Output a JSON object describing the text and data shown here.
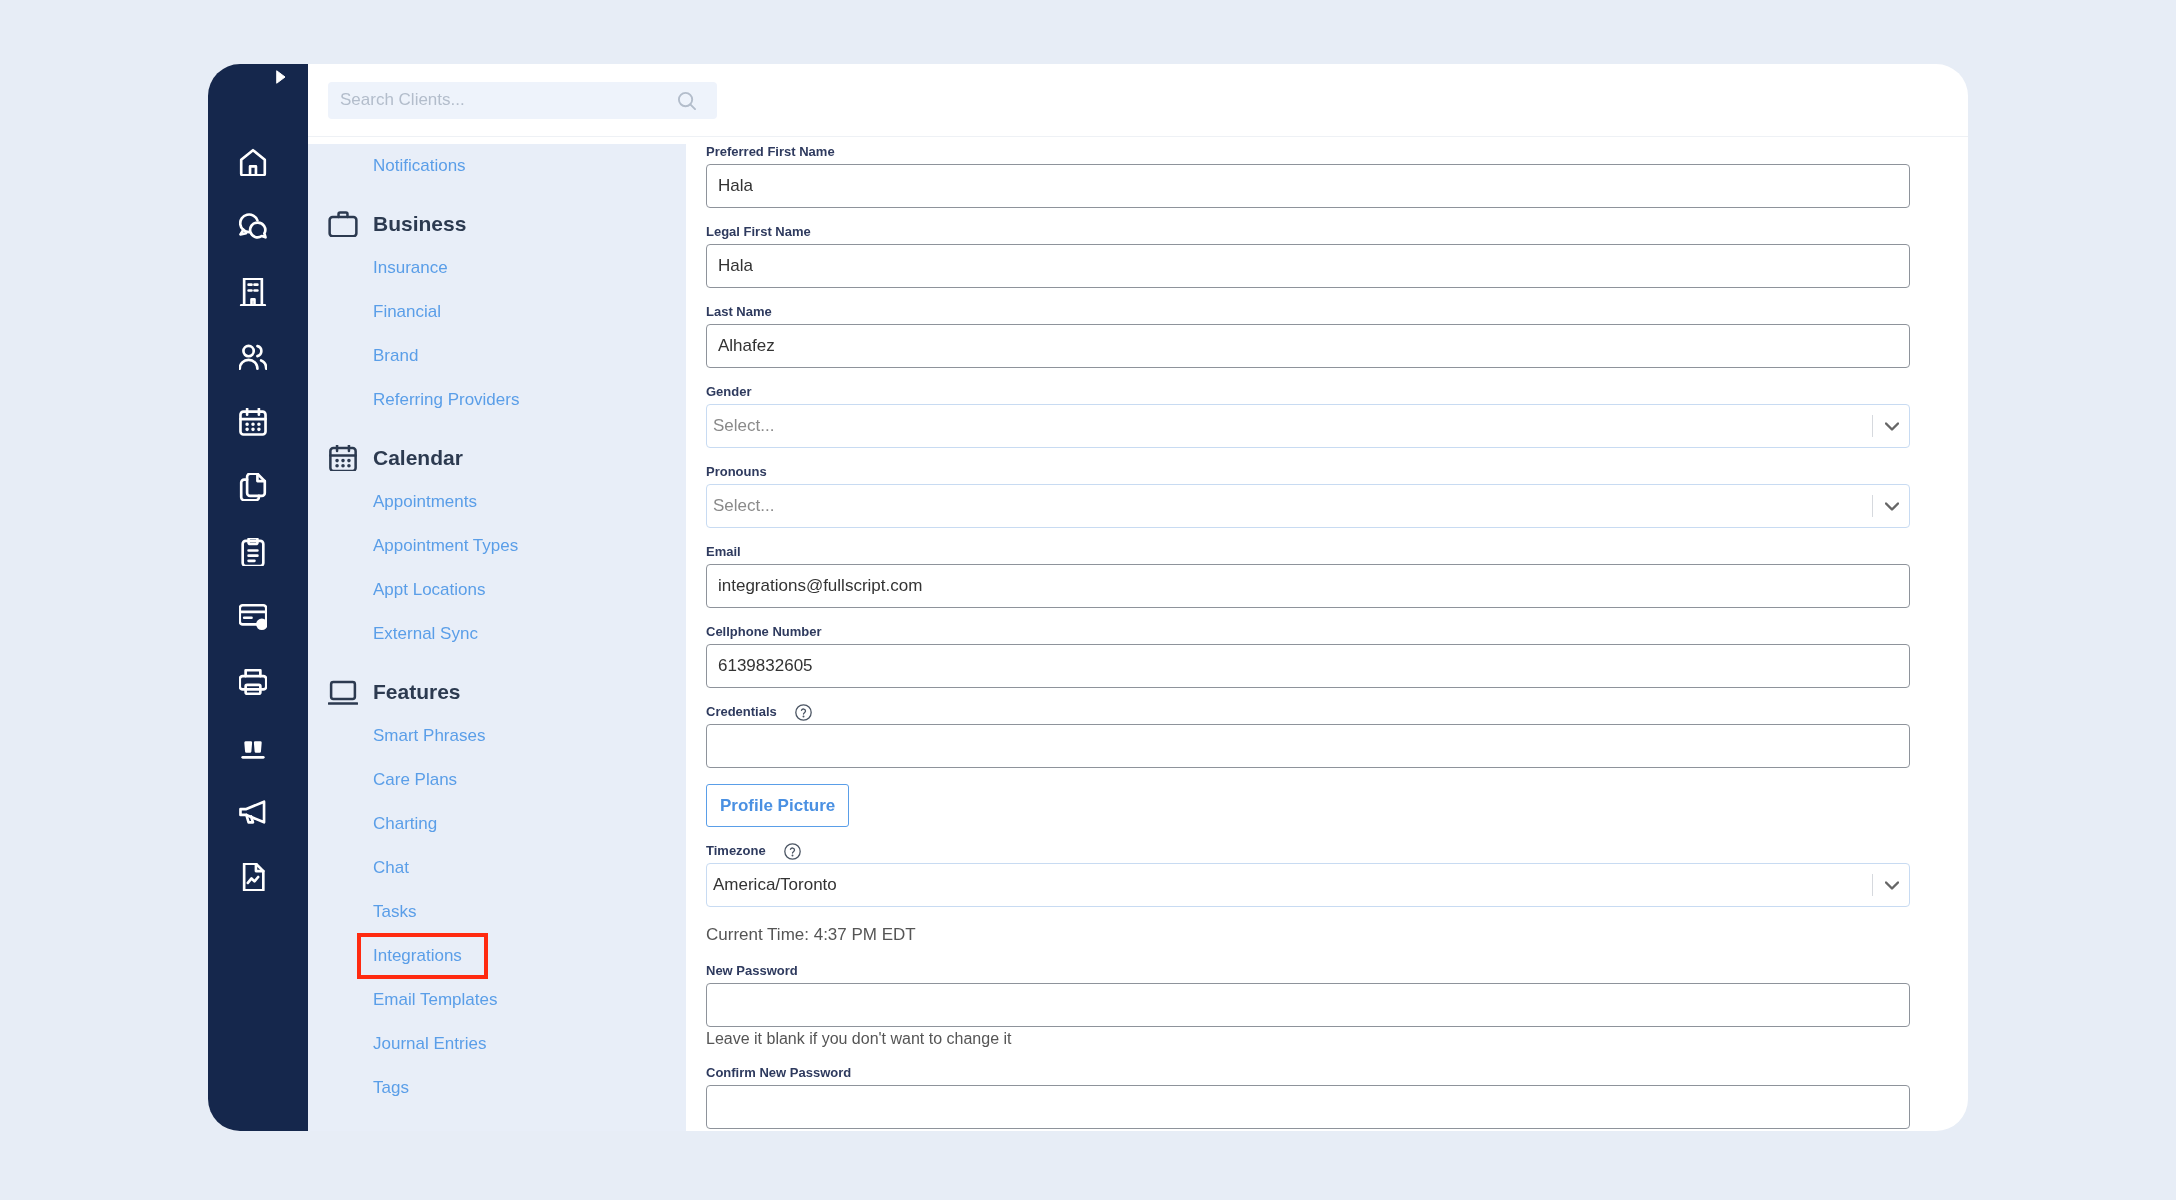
{
  "search": {
    "placeholder": "Search Clients..."
  },
  "menu": {
    "sections": [
      {
        "items": [
          {
            "label": "Notifications",
            "highlighted": false
          }
        ]
      },
      {
        "title": "Business",
        "items": [
          {
            "label": "Insurance",
            "highlighted": false
          },
          {
            "label": "Financial",
            "highlighted": false
          },
          {
            "label": "Brand",
            "highlighted": false
          },
          {
            "label": "Referring Providers",
            "highlighted": false
          }
        ]
      },
      {
        "title": "Calendar",
        "items": [
          {
            "label": "Appointments",
            "highlighted": false
          },
          {
            "label": "Appointment Types",
            "highlighted": false
          },
          {
            "label": "Appt Locations",
            "highlighted": false
          },
          {
            "label": "External Sync",
            "highlighted": false
          }
        ]
      },
      {
        "title": "Features",
        "items": [
          {
            "label": "Smart Phrases",
            "highlighted": false
          },
          {
            "label": "Care Plans",
            "highlighted": false
          },
          {
            "label": "Charting",
            "highlighted": false
          },
          {
            "label": "Chat",
            "highlighted": false
          },
          {
            "label": "Tasks",
            "highlighted": false
          },
          {
            "label": "Integrations",
            "highlighted": true
          },
          {
            "label": "Email Templates",
            "highlighted": false
          },
          {
            "label": "Journal Entries",
            "highlighted": false
          },
          {
            "label": "Tags",
            "highlighted": false
          }
        ]
      }
    ]
  },
  "form": {
    "fields": [
      {
        "kind": "text",
        "label": "Preferred First Name",
        "value": "Hala",
        "help": false
      },
      {
        "kind": "text",
        "label": "Legal First Name",
        "value": "Hala",
        "help": false
      },
      {
        "kind": "text",
        "label": "Last Name",
        "value": "Alhafez",
        "help": false
      },
      {
        "kind": "select",
        "label": "Gender",
        "placeholder": "Select...",
        "help": false
      },
      {
        "kind": "select",
        "label": "Pronouns",
        "placeholder": "Select...",
        "help": false
      },
      {
        "kind": "text",
        "label": "Email",
        "value": "integrations@fullscript.com",
        "help": false
      },
      {
        "kind": "text",
        "label": "Cellphone Number",
        "value": "6139832605",
        "help": false
      },
      {
        "kind": "text",
        "label": "Credentials",
        "help": true
      },
      {
        "kind": "button",
        "label": "Profile Picture"
      },
      {
        "kind": "select",
        "label": "Timezone",
        "value": "America/Toronto",
        "help": true
      },
      {
        "kind": "note",
        "text": "Current Time: 4:37 PM EDT"
      },
      {
        "kind": "text",
        "label": "New Password",
        "help": false,
        "hint": "Leave it blank if you don't want to change it"
      },
      {
        "kind": "text",
        "label": "Confirm New Password",
        "help": false
      }
    ]
  }
}
